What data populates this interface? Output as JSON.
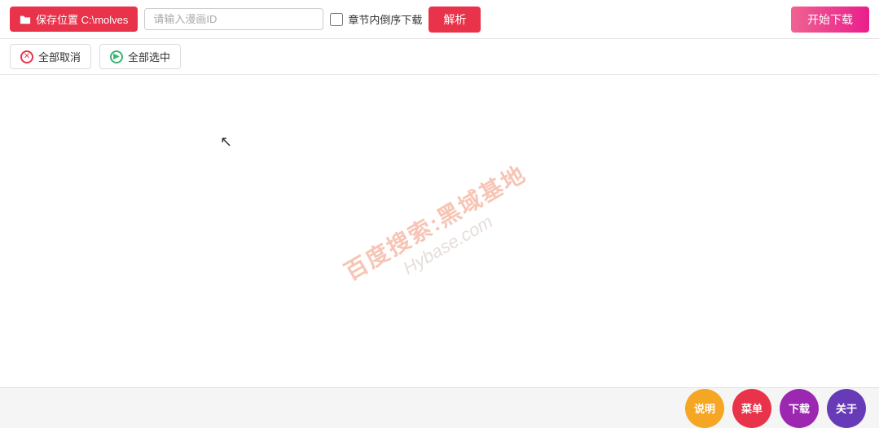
{
  "topbar": {
    "save_location_label": "保存位置 C:\\molves",
    "manga_id_placeholder": "请输入漫画ID",
    "chapter_order_label": "章节内倒序下载",
    "parse_btn_label": "解析",
    "start_download_label": "开始下载"
  },
  "actionbar": {
    "cancel_all_label": "全部取消",
    "select_all_label": "全部选中"
  },
  "watermark": {
    "cn_text": "百度搜索:黑域基地",
    "en_text": "Hybase.com"
  },
  "bottombar": {
    "explain_label": "说明",
    "menu_label": "菜单",
    "download_label": "下载",
    "about_label": "关于"
  }
}
